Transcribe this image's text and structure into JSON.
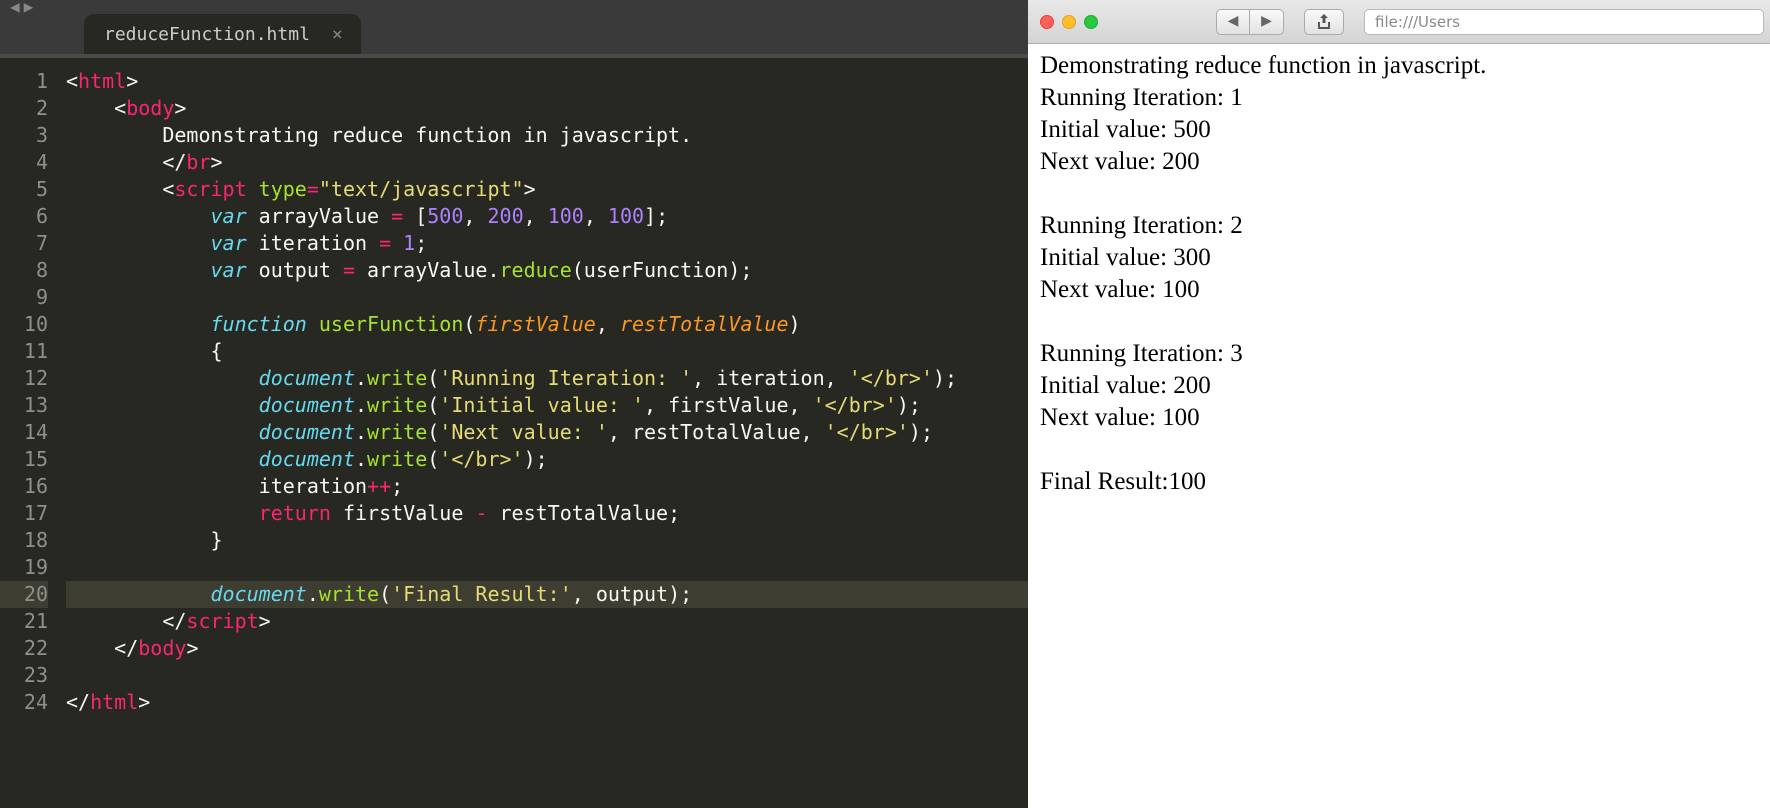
{
  "editor": {
    "nav_back": "◀",
    "nav_fwd": "▶",
    "tab_title": "reduceFunction.html",
    "line_count": 24,
    "current_line": 20,
    "code": [
      [
        {
          "c": "tagp",
          "t": "<"
        },
        {
          "c": "tag",
          "t": "html"
        },
        {
          "c": "tagp",
          "t": ">"
        }
      ],
      [
        {
          "c": "p",
          "t": "    "
        },
        {
          "c": "tagp",
          "t": "<"
        },
        {
          "c": "tag",
          "t": "body"
        },
        {
          "c": "tagp",
          "t": ">"
        }
      ],
      [
        {
          "c": "p",
          "t": "        Demonstrating reduce function in javascript."
        }
      ],
      [
        {
          "c": "p",
          "t": "        "
        },
        {
          "c": "tagp",
          "t": "</"
        },
        {
          "c": "tag",
          "t": "br"
        },
        {
          "c": "tagp",
          "t": ">"
        }
      ],
      [
        {
          "c": "p",
          "t": "        "
        },
        {
          "c": "tagp",
          "t": "<"
        },
        {
          "c": "tag",
          "t": "script"
        },
        {
          "c": "p",
          "t": " "
        },
        {
          "c": "attr",
          "t": "type"
        },
        {
          "c": "op",
          "t": "="
        },
        {
          "c": "str",
          "t": "\"text/javascript\""
        },
        {
          "c": "tagp",
          "t": ">"
        }
      ],
      [
        {
          "c": "p",
          "t": "            "
        },
        {
          "c": "kw",
          "t": "var"
        },
        {
          "c": "p",
          "t": " arrayValue "
        },
        {
          "c": "op",
          "t": "="
        },
        {
          "c": "p",
          "t": " ["
        },
        {
          "c": "num",
          "t": "500"
        },
        {
          "c": "p",
          "t": ", "
        },
        {
          "c": "num",
          "t": "200"
        },
        {
          "c": "p",
          "t": ", "
        },
        {
          "c": "num",
          "t": "100"
        },
        {
          "c": "p",
          "t": ", "
        },
        {
          "c": "num",
          "t": "100"
        },
        {
          "c": "p",
          "t": "];"
        }
      ],
      [
        {
          "c": "p",
          "t": "            "
        },
        {
          "c": "kw",
          "t": "var"
        },
        {
          "c": "p",
          "t": " iteration "
        },
        {
          "c": "op",
          "t": "="
        },
        {
          "c": "p",
          "t": " "
        },
        {
          "c": "num",
          "t": "1"
        },
        {
          "c": "p",
          "t": ";"
        }
      ],
      [
        {
          "c": "p",
          "t": "            "
        },
        {
          "c": "kw",
          "t": "var"
        },
        {
          "c": "p",
          "t": " output "
        },
        {
          "c": "op",
          "t": "="
        },
        {
          "c": "p",
          "t": " arrayValue."
        },
        {
          "c": "fn",
          "t": "reduce"
        },
        {
          "c": "p",
          "t": "(userFunction);"
        }
      ],
      [],
      [
        {
          "c": "p",
          "t": "            "
        },
        {
          "c": "kw",
          "t": "function"
        },
        {
          "c": "p",
          "t": " "
        },
        {
          "c": "fn",
          "t": "userFunction"
        },
        {
          "c": "p",
          "t": "("
        },
        {
          "c": "param",
          "t": "firstValue"
        },
        {
          "c": "p",
          "t": ", "
        },
        {
          "c": "param",
          "t": "restTotalValue"
        },
        {
          "c": "p",
          "t": ")"
        }
      ],
      [
        {
          "c": "p",
          "t": "            {"
        }
      ],
      [
        {
          "c": "p",
          "t": "                "
        },
        {
          "c": "obj",
          "t": "document"
        },
        {
          "c": "p",
          "t": "."
        },
        {
          "c": "fn",
          "t": "write"
        },
        {
          "c": "p",
          "t": "("
        },
        {
          "c": "str",
          "t": "'Running Iteration: '"
        },
        {
          "c": "p",
          "t": ", iteration, "
        },
        {
          "c": "str",
          "t": "'</br>'"
        },
        {
          "c": "p",
          "t": ");"
        }
      ],
      [
        {
          "c": "p",
          "t": "                "
        },
        {
          "c": "obj",
          "t": "document"
        },
        {
          "c": "p",
          "t": "."
        },
        {
          "c": "fn",
          "t": "write"
        },
        {
          "c": "p",
          "t": "("
        },
        {
          "c": "str",
          "t": "'Initial value: '"
        },
        {
          "c": "p",
          "t": ", firstValue, "
        },
        {
          "c": "str",
          "t": "'</br>'"
        },
        {
          "c": "p",
          "t": ");"
        }
      ],
      [
        {
          "c": "p",
          "t": "                "
        },
        {
          "c": "obj",
          "t": "document"
        },
        {
          "c": "p",
          "t": "."
        },
        {
          "c": "fn",
          "t": "write"
        },
        {
          "c": "p",
          "t": "("
        },
        {
          "c": "str",
          "t": "'Next value: '"
        },
        {
          "c": "p",
          "t": ", restTotalValue, "
        },
        {
          "c": "str",
          "t": "'</br>'"
        },
        {
          "c": "p",
          "t": ");"
        }
      ],
      [
        {
          "c": "p",
          "t": "                "
        },
        {
          "c": "obj",
          "t": "document"
        },
        {
          "c": "p",
          "t": "."
        },
        {
          "c": "fn",
          "t": "write"
        },
        {
          "c": "p",
          "t": "("
        },
        {
          "c": "str",
          "t": "'</br>'"
        },
        {
          "c": "p",
          "t": ");"
        }
      ],
      [
        {
          "c": "p",
          "t": "                iteration"
        },
        {
          "c": "op",
          "t": "++"
        },
        {
          "c": "p",
          "t": ";"
        }
      ],
      [
        {
          "c": "p",
          "t": "                "
        },
        {
          "c": "kw2",
          "t": "return"
        },
        {
          "c": "p",
          "t": " firstValue "
        },
        {
          "c": "op",
          "t": "-"
        },
        {
          "c": "p",
          "t": " restTotalValue;"
        }
      ],
      [
        {
          "c": "p",
          "t": "            }"
        }
      ],
      [],
      [
        {
          "c": "p",
          "t": "            "
        },
        {
          "c": "obj",
          "t": "document"
        },
        {
          "c": "p",
          "t": "."
        },
        {
          "c": "fn",
          "t": "write"
        },
        {
          "c": "p",
          "t": "("
        },
        {
          "c": "str",
          "t": "'Final Result:'"
        },
        {
          "c": "p",
          "t": ", output);"
        }
      ],
      [
        {
          "c": "p",
          "t": "        "
        },
        {
          "c": "tagp",
          "t": "</"
        },
        {
          "c": "tag",
          "t": "script"
        },
        {
          "c": "tagp",
          "t": ">"
        }
      ],
      [
        {
          "c": "p",
          "t": "    "
        },
        {
          "c": "tagp",
          "t": "</"
        },
        {
          "c": "tag",
          "t": "body"
        },
        {
          "c": "tagp",
          "t": ">"
        }
      ],
      [],
      [
        {
          "c": "tagp",
          "t": "</"
        },
        {
          "c": "tag",
          "t": "html"
        },
        {
          "c": "tagp",
          "t": ">"
        }
      ]
    ]
  },
  "browser": {
    "url_fragment": "file:///Users",
    "heading": "Demonstrating reduce function in javascript.",
    "iterations": [
      {
        "n": "1",
        "initial": "500",
        "next": "200"
      },
      {
        "n": "2",
        "initial": "300",
        "next": "100"
      },
      {
        "n": "3",
        "initial": "200",
        "next": "100"
      }
    ],
    "labels": {
      "running": "Running Iteration: ",
      "initial": "Initial value: ",
      "next": "Next value: ",
      "final": "Final Result:"
    },
    "final_value": "100"
  }
}
